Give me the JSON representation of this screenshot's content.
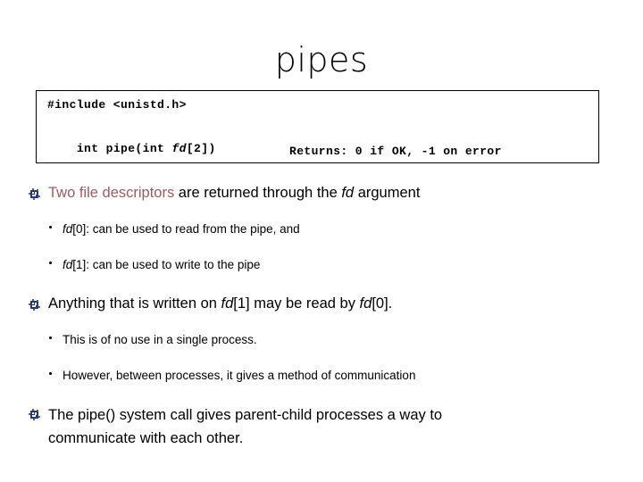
{
  "slide": {
    "title": "pipes"
  },
  "code_box": {
    "include": "#include <unistd.h>",
    "prototype_pre": "int pipe(int ",
    "prototype_italic": "fd",
    "prototype_post": "[2])",
    "returns": "Returns: 0 if OK, -1 on error"
  },
  "bullets": [
    {
      "level": 1,
      "marker": "blue-cluster-bullet-icon",
      "accent_text": "Two file descriptors",
      "text_mid": " are returned through the ",
      "italic_text": "fd",
      "text_end": " argument"
    },
    {
      "level": 2,
      "marker": "round-dot-bullet-icon",
      "italic_text": "fd",
      "text_end": "[0]: can be used to read from the pipe, and"
    },
    {
      "level": 2,
      "marker": "round-dot-bullet-icon",
      "italic_text": "fd",
      "text_end": "[1]: can be used to write to the pipe"
    },
    {
      "level": 1,
      "marker": "blue-cluster-bullet-icon",
      "text_start": "Anything that is written on ",
      "italic_1": "fd",
      "text_mid": "[1] may be read by ",
      "italic_2": "fd",
      "text_end": "[0]."
    },
    {
      "level": 2,
      "marker": "round-dot-bullet-icon",
      "text_end": "This is of no use in a single process."
    },
    {
      "level": 2,
      "marker": "round-dot-bullet-icon",
      "text_end": "However, between processes, it gives a method of communication"
    },
    {
      "level": 1,
      "marker": "blue-cluster-bullet-icon",
      "text_end": "The pipe() system call gives parent-child processes a way to communicate with each other."
    }
  ],
  "colors": {
    "accent_rose": "#9e5a63",
    "bullet_blue": "#26348c",
    "bullet_green": "#3f7a3f",
    "text_black": "#000000",
    "background": "#ffffff",
    "box_border": "#000000"
  }
}
